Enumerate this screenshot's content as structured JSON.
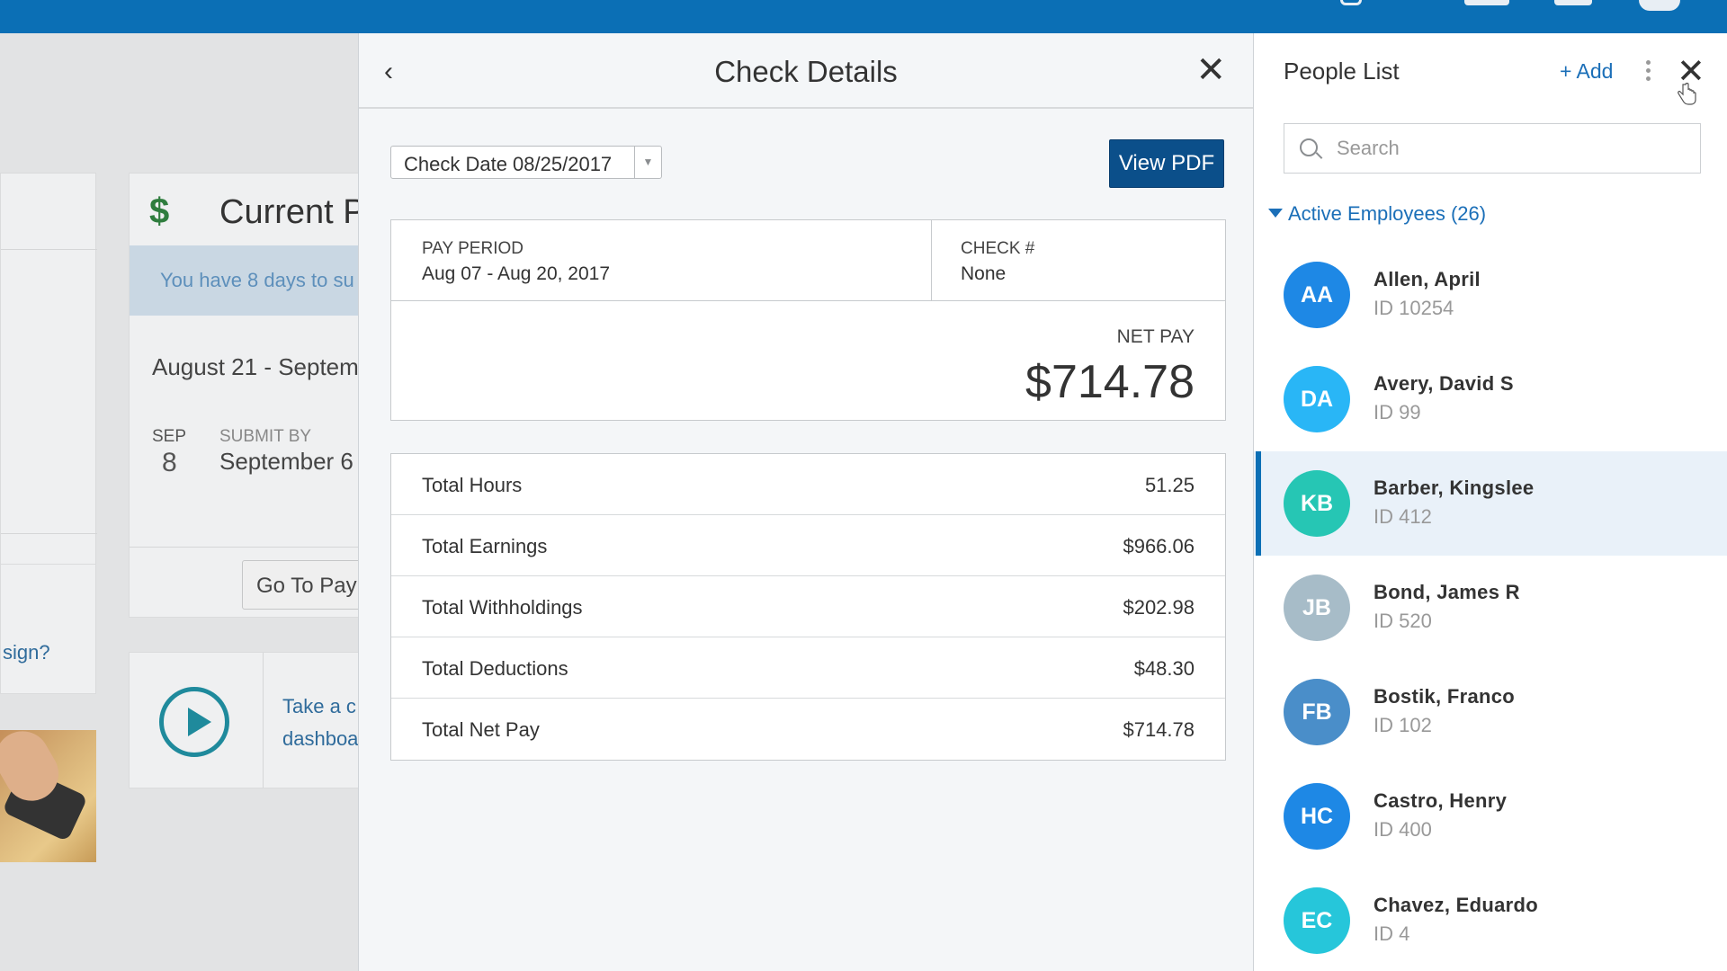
{
  "background": {
    "pay_card": {
      "title": "Current P",
      "notice": "You have 8 days to su",
      "period": "August 21 - Septem",
      "month": "SEP",
      "day": "8",
      "submit_label": "SUBMIT BY",
      "submit_value": "September 6",
      "go_button": "Go To Payr"
    },
    "left_question": "sign?",
    "tour": {
      "line1": "Take a c",
      "line2": "dashboa"
    }
  },
  "check_details": {
    "title": "Check Details",
    "check_date": "Check Date 08/25/2017",
    "view_pdf": "View PDF",
    "pay_period_label": "PAY PERIOD",
    "pay_period_value": "Aug 07 - Aug 20, 2017",
    "check_no_label": "CHECK #",
    "check_no_value": "None",
    "net_pay_label": "NET PAY",
    "net_pay_value": "$714.78",
    "totals": [
      {
        "label": "Total Hours",
        "value": "51.25"
      },
      {
        "label": "Total Earnings",
        "value": "$966.06"
      },
      {
        "label": "Total Withholdings",
        "value": "$202.98"
      },
      {
        "label": "Total Deductions",
        "value": "$48.30"
      },
      {
        "label": "Total Net Pay",
        "value": "$714.78"
      }
    ]
  },
  "people_list": {
    "title": "People List",
    "add_label": "+ Add",
    "search_placeholder": "Search",
    "group_label": "Active Employees (26)",
    "people": [
      {
        "initials": "AA",
        "name": "Allen, April",
        "id": "ID 10254",
        "color": "#1e88e5"
      },
      {
        "initials": "DA",
        "name": "Avery, David S",
        "id": "ID 99",
        "color": "#29b6f6"
      },
      {
        "initials": "KB",
        "name": "Barber, Kingslee",
        "id": "ID 412",
        "color": "#26c6b4",
        "selected": true
      },
      {
        "initials": "JB",
        "name": "Bond, James R",
        "id": "ID 520",
        "color": "#a7bcc8"
      },
      {
        "initials": "FB",
        "name": "Bostik, Franco",
        "id": "ID 102",
        "color": "#4a8ec9"
      },
      {
        "initials": "HC",
        "name": "Castro, Henry",
        "id": "ID 400",
        "color": "#1e88e5"
      },
      {
        "initials": "EC",
        "name": "Chavez, Eduardo",
        "id": "ID 4",
        "color": "#26c6da"
      }
    ]
  }
}
